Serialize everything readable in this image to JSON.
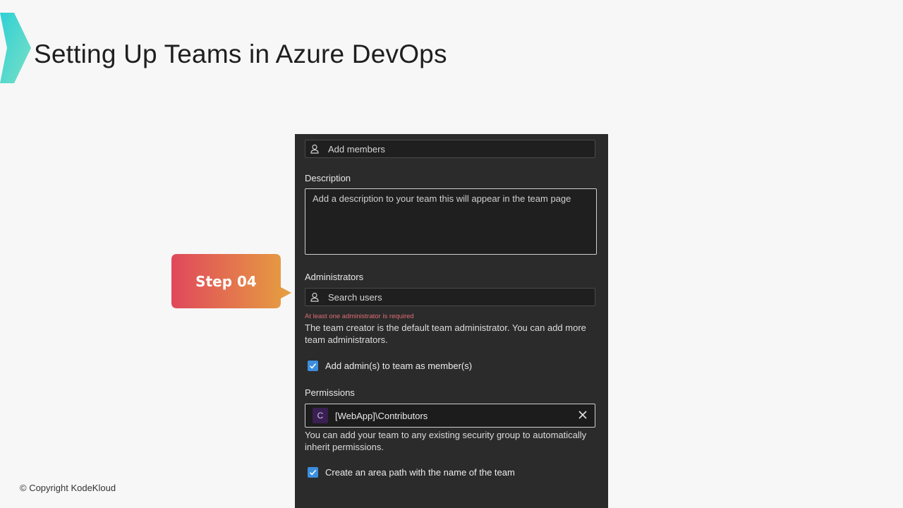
{
  "slide": {
    "title": "Setting Up Teams in Azure DevOps",
    "copyright": "© Copyright KodeKloud",
    "step_label": "Step 04"
  },
  "form": {
    "members_placeholder": "Add members",
    "description_label": "Description",
    "description_placeholder": "Add a description to your team this will appear in the team page",
    "administrators_label": "Administrators",
    "search_users_placeholder": "Search users",
    "admin_error": "At least one administrator is required",
    "admin_helper": "The team creator is the default team administrator. You can add more team administrators.",
    "add_admins_checkbox_label": "Add admin(s) to team as member(s)",
    "add_admins_checked": true,
    "permissions_label": "Permissions",
    "permission_avatar_letter": "C",
    "permission_value": "[WebApp]\\Contributors",
    "permissions_helper": "You can add your team to any existing security group to automatically inherit permissions.",
    "area_path_checkbox_label": "Create an area path with the name of the team",
    "area_path_checked": true
  },
  "colors": {
    "accent_teal": "#3fd6d4",
    "callout_start": "#e0485c",
    "callout_end": "#e6a040",
    "checkbox_blue": "#3b8ede",
    "error_red": "#e06c75"
  }
}
